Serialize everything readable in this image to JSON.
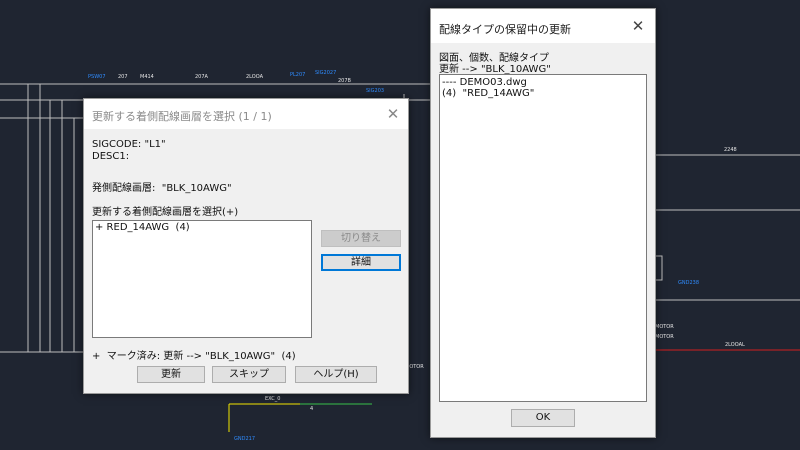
{
  "cad": {
    "labels": [
      "207",
      "M414",
      "207A",
      "207B",
      "2248",
      "MOTOR",
      "MOTOR",
      "MOTOR",
      "2LOOA",
      "2LOOAL",
      "EXC_0",
      "4",
      "GND238",
      "GND217"
    ],
    "blue_labels": [
      "PSW07",
      "PL207",
      "SIG2027",
      "SIG203",
      "GND238",
      "GND217"
    ]
  },
  "dialog_select": {
    "title": "更新する着側配線画層を選択 (1 / 1)",
    "sigcode": "SIGCODE: \"L1\"",
    "desc1": "DESC1:",
    "source_layer": "発側配線画層:  \"BLK_10AWG\"",
    "list_label": "更新する着側配線画層を選択(+)",
    "list_items": [
      "+ RED_14AWG  (4)"
    ],
    "switch_button": "切り替え",
    "details_button": "詳細",
    "marked_status": "+  マーク済み: 更新 --> \"BLK_10AWG\"  (4)",
    "update_button": "更新",
    "skip_button": "スキップ",
    "help_button": "ヘルプ(H)"
  },
  "dialog_pending": {
    "title": "配線タイプの保留中の更新",
    "header1": "図面、個数、配線タイプ",
    "header2": "更新 --> \"BLK_10AWG\"",
    "list_items": [
      "---- DEMO03.dwg",
      "(4)  \"RED_14AWG\""
    ],
    "ok_button": "OK"
  }
}
